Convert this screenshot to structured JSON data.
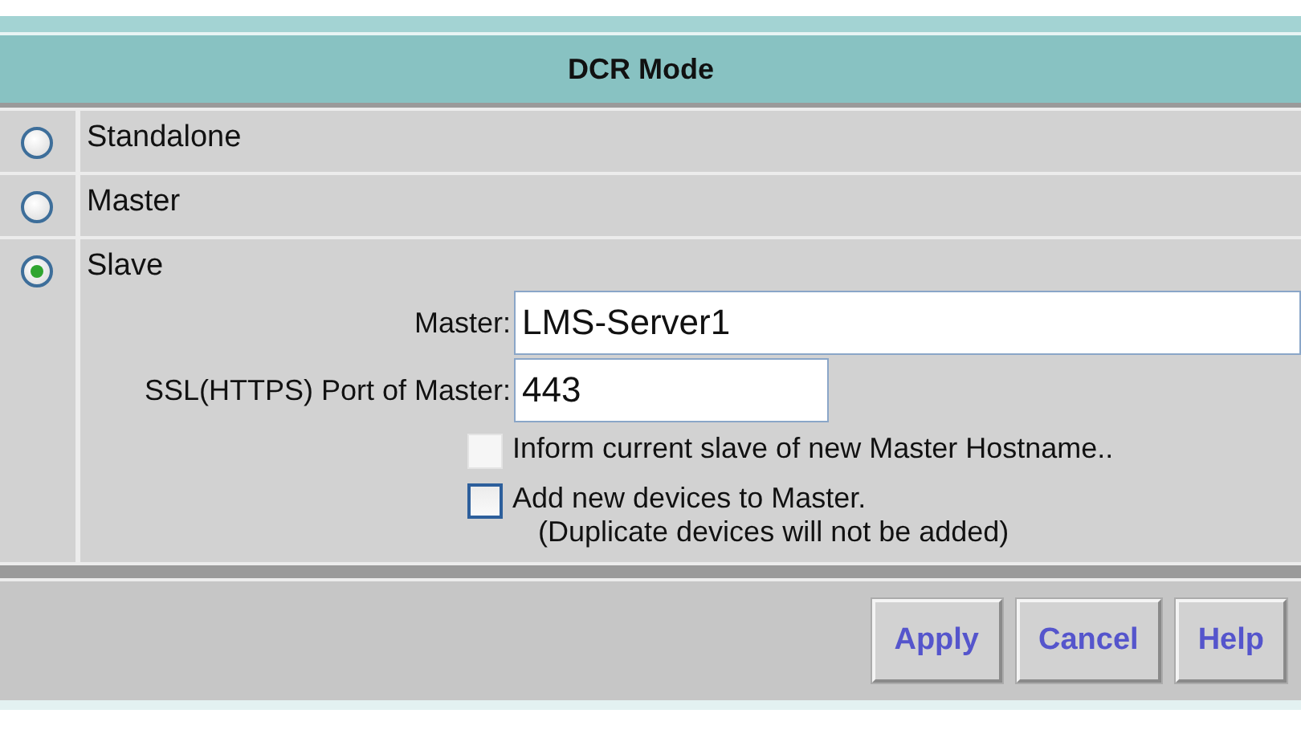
{
  "panel": {
    "title": "DCR Mode"
  },
  "modes": [
    {
      "label": "Standalone",
      "selected": false
    },
    {
      "label": "Master",
      "selected": false
    },
    {
      "label": "Slave",
      "selected": true
    }
  ],
  "slave_settings": {
    "master": {
      "label": "Master:",
      "value": "LMS-Server1"
    },
    "port": {
      "label": "SSL(HTTPS) Port of Master:",
      "value": "443"
    },
    "options": [
      {
        "label": "Inform current slave of new Master Hostname..",
        "checked": false,
        "disabled": true
      },
      {
        "label": "Add new devices to Master.",
        "note": "(Duplicate devices will not be added)",
        "checked": false,
        "disabled": false
      }
    ]
  },
  "buttons": [
    "Apply",
    "Cancel",
    "Help"
  ]
}
